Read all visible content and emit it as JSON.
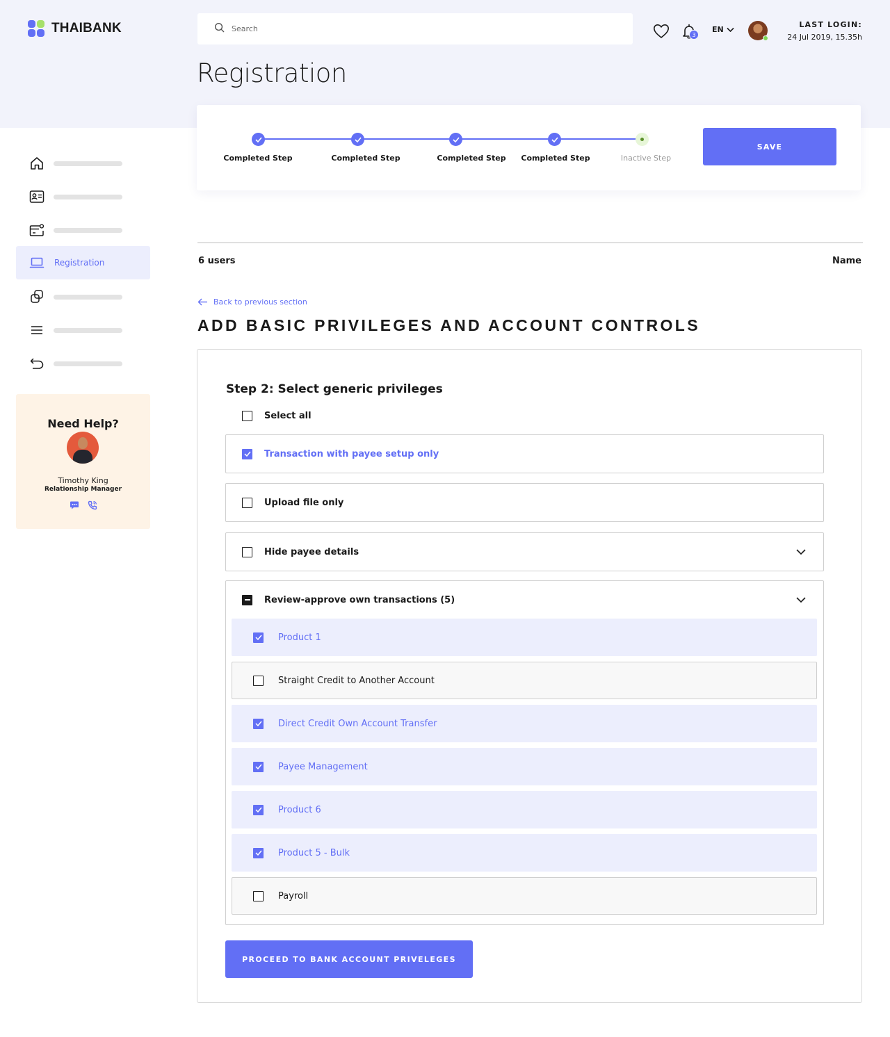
{
  "brand": {
    "name": "THAIBANK"
  },
  "search": {
    "placeholder": "Search"
  },
  "header": {
    "notifications_count": "3",
    "language": "EN",
    "last_login_label": "LAST LOGIN:",
    "last_login_time": "24 Jul 2019, 15.35h"
  },
  "page": {
    "title": "Registration"
  },
  "stepper": {
    "steps": [
      {
        "label": "Completed Step",
        "state": "completed"
      },
      {
        "label": "Completed Step",
        "state": "completed"
      },
      {
        "label": "Completed Step",
        "state": "completed"
      },
      {
        "label": "Completed Step",
        "state": "completed"
      },
      {
        "label": "Inactive Step",
        "state": "inactive"
      }
    ],
    "save_label": "SAVE"
  },
  "sidebar": {
    "items": [
      {
        "icon": "home-icon",
        "label": ""
      },
      {
        "icon": "id-card-icon",
        "label": ""
      },
      {
        "icon": "card-settings-icon",
        "label": ""
      },
      {
        "icon": "laptop-icon",
        "label": "Registration",
        "active": true
      },
      {
        "icon": "copy-icon",
        "label": ""
      },
      {
        "icon": "menu-icon",
        "label": ""
      },
      {
        "icon": "undo-icon",
        "label": ""
      }
    ],
    "help": {
      "title": "Need Help?",
      "name": "Timothy King",
      "role": "Relationship Manager"
    }
  },
  "list": {
    "users_count": "6 users",
    "name_column": "Name"
  },
  "section": {
    "back_label": "Back to previous section",
    "title": "ADD BASIC PRIVILEGES AND ACCOUNT CONTROLS"
  },
  "privileges": {
    "step_title": "Step 2: Select generic privileges",
    "select_all_label": "Select all",
    "items": [
      {
        "label": "Transaction with payee setup only",
        "checked": true
      },
      {
        "label": "Upload file only",
        "checked": false
      },
      {
        "label": "Hide payee details",
        "checked": false,
        "expandable": true
      }
    ],
    "group": {
      "label": "Review-approve own transactions (5)",
      "state": "indeterminate",
      "items": [
        {
          "label": "Product 1",
          "checked": true
        },
        {
          "label": "Straight Credit to Another Account",
          "checked": false
        },
        {
          "label": "Direct Credit Own Account Transfer",
          "checked": true
        },
        {
          "label": "Payee Management",
          "checked": true
        },
        {
          "label": "Product 6",
          "checked": true
        },
        {
          "label": "Product 5 - Bulk",
          "checked": true
        },
        {
          "label": "Payroll",
          "checked": false
        }
      ]
    },
    "proceed_label": "PROCEED TO BANK ACCOUNT PRIVELEGES"
  },
  "colors": {
    "accent": "#626ff5",
    "header_bg": "#f2f3fb",
    "active_bg": "#eceefd",
    "help_bg": "#fef3e6",
    "inactive_dot": "#e7f6d8"
  }
}
